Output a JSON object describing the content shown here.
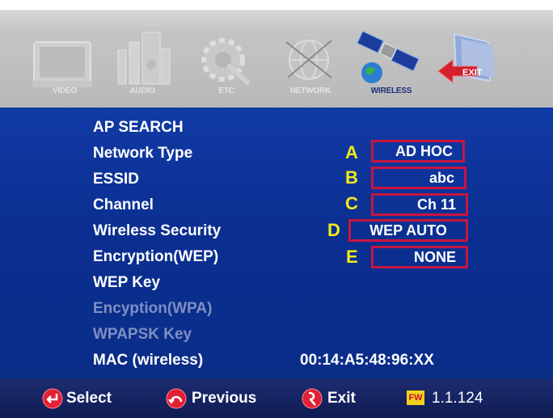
{
  "colors": {
    "panel_blue": "#0b2f91",
    "highlight_border": "#c8153f",
    "marker_yellow": "#f5ea1a",
    "disabled_text": "#7f8fc4",
    "bottom_bar": "#14215f"
  },
  "menu": {
    "items": [
      {
        "label": "VIDEO",
        "icon": "tv-icon"
      },
      {
        "label": "AUDIO",
        "icon": "speaker-icon"
      },
      {
        "label": "ETC",
        "icon": "gear-icon"
      },
      {
        "label": "NETWORK",
        "icon": "network-globe-icon"
      },
      {
        "label": "WIRELESS",
        "icon": "satellite-icon",
        "active": true
      },
      {
        "label": "EXIT",
        "icon": "exit-folder-icon"
      }
    ]
  },
  "settings": {
    "ap_search": "AP SEARCH",
    "network_type": {
      "label": "Network Type",
      "marker": "A",
      "value": "AD HOC"
    },
    "essid": {
      "label": "ESSID",
      "marker": "B",
      "value": "abc"
    },
    "channel": {
      "label": "Channel",
      "marker": "C",
      "value": "Ch 11"
    },
    "wireless_security": {
      "label": "Wireless Security",
      "marker": "D",
      "value": "WEP AUTO"
    },
    "encryption_wep": {
      "label": "Encryption(WEP)",
      "marker": "E",
      "value": "NONE"
    },
    "wep_key": {
      "label": "WEP Key"
    },
    "encryption_wpa": {
      "label": "Encyption(WPA)",
      "disabled": true
    },
    "wpapsk_key": {
      "label": "WPAPSK Key",
      "disabled": true
    },
    "mac": {
      "label": "MAC (wireless)",
      "value": "00:14:A5:48:96:XX"
    }
  },
  "hints": {
    "select": "Select",
    "previous": "Previous",
    "exit": "Exit",
    "fw_badge": "FW",
    "fw_version": "1.1.124"
  }
}
